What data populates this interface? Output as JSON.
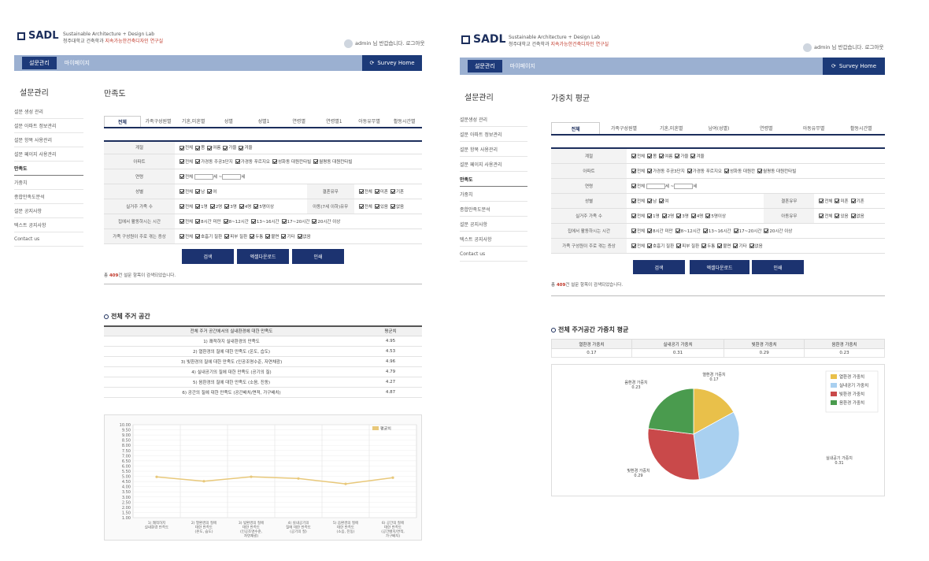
{
  "left": {
    "logo": "SADL",
    "lab_name": "Sustainable Architecture + Design Lab",
    "lab_desc_a": "청주대학교 건축학과 ",
    "lab_desc_b": "지속가능한건축디자인 연구실",
    "user": "admin 님 반갑습니다. 로그아웃",
    "nav": {
      "active": "설문관리",
      "item": "마이페이지",
      "home": "Survey Home"
    },
    "side_title": "설문관리",
    "side_items": [
      "설문 생성 관리",
      "설문 아파트 정보관리",
      "설문 항목 사용관리",
      "설문 페이지 사용관리",
      "만족도",
      "가중치",
      "종합만족도분석",
      "설문 공지사항",
      "텍스트 공지사항",
      "Contact us"
    ],
    "page_title": "만족도",
    "tabs": [
      "전체",
      "가족구성원별",
      "기혼,미혼별",
      "성별",
      "성별1",
      "연령별",
      "연령별1",
      "아동유무별",
      "활동시간별"
    ],
    "filter": {
      "r1_label": "계절",
      "r1_opts": [
        "전체",
        "봄",
        "여름",
        "가을",
        "겨울"
      ],
      "r2_label": "아파트",
      "r2_opts": [
        "전체",
        "가경동 주공3단지",
        "가경동 푸르지오",
        "성화동 대원칸타빌",
        "월평동 대원칸타빌"
      ],
      "r3_label": "연령",
      "r3_opts": [
        "전체"
      ],
      "r3_a": "세 ~",
      "r3_b": "세",
      "r4_label": "성별",
      "r4_opts": [
        "전체",
        "남",
        "여"
      ],
      "r4_label2": "결혼유무",
      "r4_opts2": [
        "전체",
        "미혼",
        "기혼"
      ],
      "r5_label": "실거주 가족 수",
      "r5_opts": [
        "전체",
        "1명",
        "2명",
        "3명",
        "4명",
        "5명이상"
      ],
      "r5_label2": "아동(7세 이하)유무",
      "r5_opts2": [
        "전체",
        "있음",
        "없음"
      ],
      "r6_label": "집에서 활동하시는 시간",
      "r6_opts": [
        "전체",
        "8시간 미만",
        "8~12시간",
        "13~16시간",
        "17~20시간",
        "20시간 이상"
      ],
      "r7_label": "가족 구성원이 주로 겪는 증상",
      "r7_opts": [
        "전체",
        "호흡기 질환",
        "피부 질환",
        "두통",
        "불면",
        "기타",
        "없음"
      ]
    },
    "buttons": [
      "검색",
      "엑셀다운로드",
      "인쇄"
    ],
    "result_prefix": "총 ",
    "result_count": "409",
    "result_suffix": "건 설문 항목이 검색되었습니다.",
    "section_title": "전체 주거 공간",
    "table_headers": [
      "전체 주거 공간에서의 실내환경에 대한 만족도",
      "평균치"
    ],
    "table_rows": [
      [
        "1) 쾌적하지 실내환경의 만족도",
        "4.95"
      ],
      [
        "2) 열환경의 질에 대한 만족도 (온도, 습도)",
        "4.53"
      ],
      [
        "3) 빛환경의 질에 대한 만족도 (인공조명수준, 자연채광)",
        "4.96"
      ],
      [
        "4) 실내공기의 질에 대한 만족도 (공기의 질)",
        "4.79"
      ],
      [
        "5) 음환경의 질에 대한 만족도 (소음, 진동)",
        "4.27"
      ],
      [
        "6) 공간의 질에 대한 만족도 (공간배치/면적, 가구배치)",
        "4.87"
      ]
    ],
    "legend": "평균치",
    "chart_data": {
      "type": "line",
      "categories": [
        "1) 쾌적하지 실내환경 만족도",
        "2) 열환경의 질에 대한 만족도 (온도, 습도)",
        "3) 빛환경의 질에 대한 만족도 (인공조명수준, 자연채광)",
        "4) 실내공기의 질에 대한 만족도 (공기의 질)",
        "5) 음환경의 질에 대한 만족도 (소음, 진동)",
        "6) 공간의 질에 대한 만족도 (공간배치/면적, 가구배치)"
      ],
      "series": [
        {
          "name": "평균치",
          "values": [
            4.95,
            4.53,
            4.96,
            4.79,
            4.27,
            4.87
          ]
        }
      ],
      "ylim": [
        1.0,
        10.0
      ],
      "yticks": [
        "10.00",
        "9.50",
        "9.00",
        "8.50",
        "8.00",
        "7.50",
        "7.00",
        "6.50",
        "6.00",
        "5.50",
        "5.00",
        "4.50",
        "4.00",
        "3.50",
        "3.00",
        "2.50",
        "2.00",
        "1.50",
        "1.00"
      ],
      "color": "#e8c87a"
    }
  },
  "right": {
    "logo": "SADL",
    "lab_name": "Sustainable Architecture + Design Lab",
    "lab_desc_a": "청주대학교 건축학과 ",
    "lab_desc_b": "지속가능한건축디자인 연구실",
    "user": "admin 님 반갑습니다. 로그아웃",
    "nav": {
      "active": "설문관리",
      "item": "마이페이지",
      "home": "Survey Home"
    },
    "side_title": "설문관리",
    "side_items": [
      "설문생성 관리",
      "설문 아파트 정보관리",
      "설문 항목 사용관리",
      "설문 페이지 사용관리",
      "만족도",
      "가중치",
      "종합만족도분석",
      "설문 공지사항",
      "텍스트 공지사항",
      "Contact us"
    ],
    "page_title": "가중치 평균",
    "tabs": [
      "전체",
      "가족구성원별",
      "기혼,미혼별",
      "남여(성별)",
      "연령별",
      "아동유무별",
      "활동시간별"
    ],
    "filter": {
      "r1_label": "계절",
      "r1_opts": [
        "전체",
        "봄",
        "여름",
        "가을",
        "겨울"
      ],
      "r2_label": "아파트",
      "r2_opts": [
        "전체",
        "가경동 주공3단지",
        "가경동 푸르지오",
        "성화동 대원칸",
        "월평동 대원칸타빌"
      ],
      "r3_label": "연령",
      "r3_opts": [
        "전체"
      ],
      "r3_a": "세 ~",
      "r3_b": "세",
      "r4_label": "성별",
      "r4_opts": [
        "전체",
        "남",
        "여"
      ],
      "r4_label2": "결혼유무",
      "r4_opts2": [
        "전체",
        "미혼",
        "기혼"
      ],
      "r5_label": "실거주 가족 수",
      "r5_opts": [
        "전체",
        "1명",
        "2명",
        "3명",
        "4명",
        "5명이상"
      ],
      "r5_label2": "아동유무",
      "r5_opts2": [
        "전체",
        "있음",
        "없음"
      ],
      "r6_label": "집에서 활동하시는 시간",
      "r6_opts": [
        "전체",
        "8시간 미만",
        "8~12시간",
        "13~16시간",
        "17~20시간",
        "20시간 이상"
      ],
      "r7_label": "가족 구성원이 주로 겪는 증상",
      "r7_opts": [
        "전체",
        "호흡기 질환",
        "피부 질환",
        "두통",
        "불면",
        "기타",
        "없음"
      ]
    },
    "buttons": [
      "검색",
      "엑셀다운로드",
      "인쇄"
    ],
    "result_prefix": "총 ",
    "result_count": "409",
    "result_suffix": "건 설문 항목이 검색되었습니다.",
    "section_title": "전체 주거공간 가중치 평균",
    "w_headers": [
      "열환경 가중치",
      "실내공기 가중치",
      "빛환경 가중치",
      "음환경 가중치"
    ],
    "w_values": [
      "0.17",
      "0.31",
      "0.29",
      "0.23"
    ],
    "chart_data": {
      "type": "pie",
      "labels": [
        "열환경 가중치",
        "실내공기 가중치",
        "빛환경 가중치",
        "음환경 가중치"
      ],
      "values": [
        0.17,
        0.31,
        0.29,
        0.23
      ],
      "colors": [
        "#e9c04a",
        "#a9d0f0",
        "#c9494a",
        "#4a9b4e"
      ],
      "legend_position": "top-right"
    }
  }
}
